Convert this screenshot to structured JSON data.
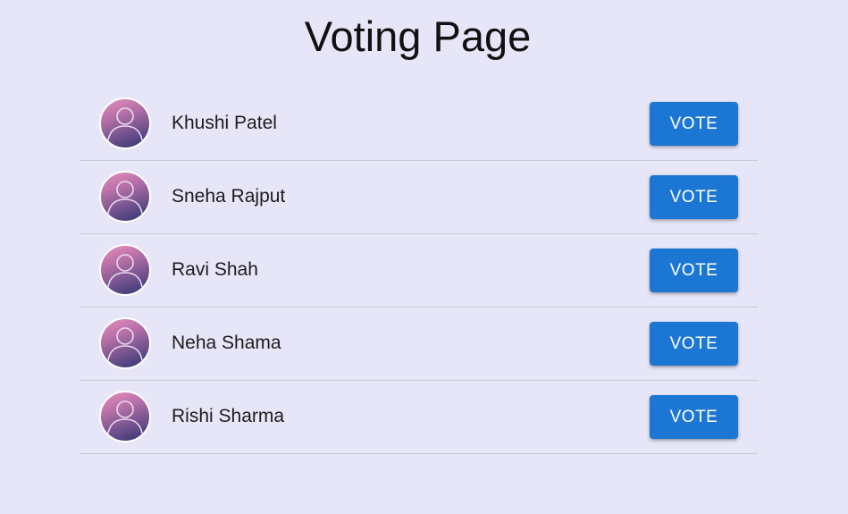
{
  "page": {
    "title": "Voting Page"
  },
  "candidates": [
    {
      "name": "Khushi Patel",
      "vote_label": "VOTE",
      "avatar_icon": "user-avatar-icon"
    },
    {
      "name": "Sneha Rajput",
      "vote_label": "VOTE",
      "avatar_icon": "user-avatar-icon"
    },
    {
      "name": "Ravi Shah",
      "vote_label": "VOTE",
      "avatar_icon": "user-avatar-icon"
    },
    {
      "name": "Neha Shama",
      "vote_label": "VOTE",
      "avatar_icon": "user-avatar-icon"
    },
    {
      "name": "Rishi Sharma",
      "vote_label": "VOTE",
      "avatar_icon": "user-avatar-icon"
    }
  ],
  "colors": {
    "background": "#e6e6f8",
    "vote_button": "#1c77d4",
    "divider": "#c8c8d6"
  }
}
